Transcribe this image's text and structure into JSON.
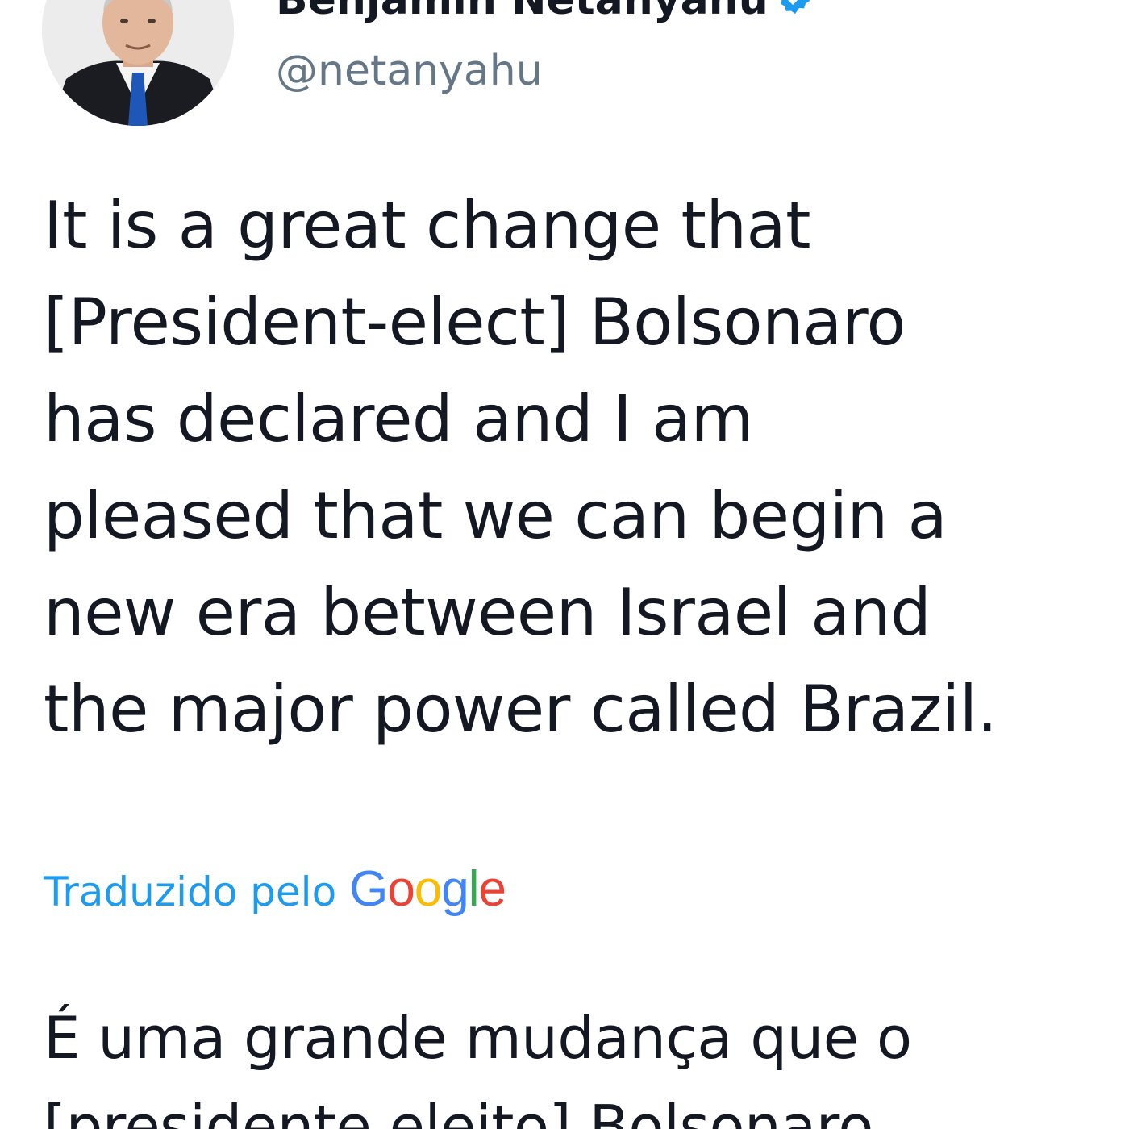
{
  "user": {
    "display_name": "Benjamin Netanyahu",
    "handle": "@netanyahu",
    "verified_icon": "verified-badge-icon"
  },
  "tweet": {
    "text": "It is a great change that\n[President-elect] Bolsonaro\nhas declared and I am\npleased that we can begin a\nnew era between Israel and\nthe major power called Brazil."
  },
  "translation": {
    "label": "Traduzido pelo",
    "provider_letters": [
      "G",
      "o",
      "o",
      "g",
      "l",
      "e"
    ],
    "provider_colors": [
      "#4285F4",
      "#EA4335",
      "#FBBC05",
      "#4285F4",
      "#34A853",
      "#EA4335"
    ],
    "text": "É uma grande mudança que o\n[presidente eleito] Bolsonaro"
  },
  "colors": {
    "link": "#1d9bf0",
    "handle": "#657786",
    "text": "#141823"
  }
}
